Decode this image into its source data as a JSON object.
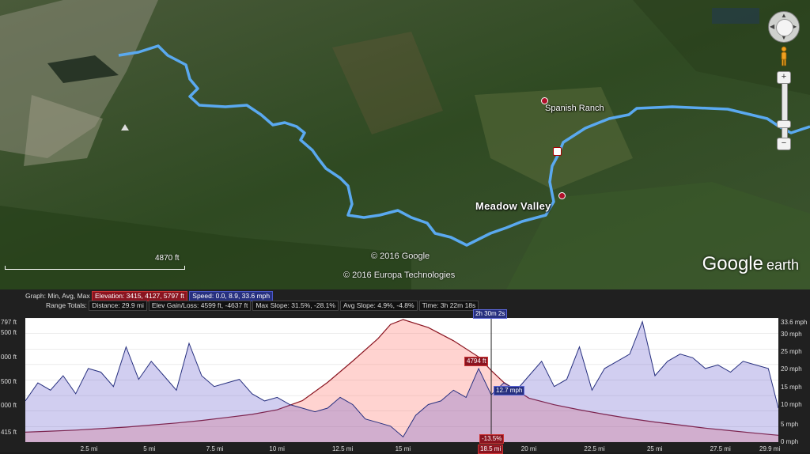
{
  "map": {
    "places": {
      "spanish_ranch": "Spanish Ranch",
      "meadow_valley": "Meadow Valley"
    },
    "scale_label": "4870 ft",
    "credits": {
      "google": "© 2016 Google",
      "europa": "© 2016 Europa Technologies"
    },
    "brand": {
      "main": "Google",
      "suffix": "earth"
    },
    "route_color": "#5aa9f0"
  },
  "profile": {
    "graph_label": "Graph: Min, Avg, Max",
    "elevation_tag": "Elevation: 3415, 4127, 5797 ft",
    "speed_tag": "Speed: 0.0, 8.9, 33.6 mph",
    "range_label": "Range Totals:",
    "distance": "Distance: 29.9 mi",
    "gain_loss": "Elev Gain/Loss: 4599 ft, -4637 ft",
    "max_slope": "Max Slope: 31.5%, -28.1%",
    "avg_slope": "Avg Slope: 4.9%, -4.8%",
    "time": "Time: 3h 22m 18s",
    "cursor_time": "2h 30m 2s",
    "cursor_elev": "4794 ft",
    "cursor_speed": "12.7 mph",
    "cursor_slope": "-13.5%",
    "cursor_dist": "18.5 mi",
    "elev_color": "#8a1420",
    "speed_color": "#27307f"
  },
  "chart_data": {
    "type": "area",
    "x_unit": "mi",
    "x_ticks": [
      "2.5 mi",
      "5 mi",
      "7.5 mi",
      "10 mi",
      "12.5 mi",
      "15 mi",
      "18.5 mi",
      "20 mi",
      "22.5 mi",
      "25 mi",
      "27.5 mi",
      "29.9 mi"
    ],
    "y_left_ticks": [
      "797 ft",
      "500 ft",
      "000 ft",
      "500 ft",
      "000 ft",
      "415 ft"
    ],
    "y_right_ticks": [
      "33.6 mph",
      "30 mph",
      "25 mph",
      "20 mph",
      "15 mph",
      "10 mph",
      "5 mph",
      "0 mph"
    ],
    "xlim": [
      0,
      29.9
    ],
    "elev_ylim": [
      3415,
      5797
    ],
    "speed_ylim": [
      0,
      33.6
    ],
    "series": [
      {
        "name": "Elevation",
        "unit": "ft",
        "x": [
          0,
          1,
          2,
          3,
          4,
          5,
          6,
          7,
          8,
          9,
          10,
          11,
          12,
          13,
          14,
          14.5,
          15,
          16,
          17,
          18,
          18.5,
          19,
          20,
          21,
          22,
          23,
          24,
          25,
          26,
          27,
          28,
          29,
          29.9
        ],
        "values": [
          3580,
          3600,
          3620,
          3650,
          3680,
          3720,
          3760,
          3810,
          3870,
          3930,
          4020,
          4200,
          4560,
          4980,
          5420,
          5700,
          5797,
          5640,
          5380,
          5060,
          4794,
          4560,
          4250,
          4120,
          4020,
          3930,
          3850,
          3780,
          3720,
          3660,
          3610,
          3560,
          3520
        ]
      },
      {
        "name": "Speed",
        "unit": "mph",
        "x": [
          0,
          0.5,
          1,
          1.5,
          2,
          2.5,
          3,
          3.5,
          4,
          4.5,
          5,
          5.5,
          6,
          6.5,
          7,
          7.5,
          8,
          8.5,
          9,
          9.5,
          10,
          10.5,
          11,
          11.5,
          12,
          12.5,
          13,
          13.5,
          14,
          14.5,
          15,
          15.5,
          16,
          16.5,
          17,
          17.5,
          18,
          18.5,
          19,
          19.5,
          20,
          20.5,
          21,
          21.5,
          22,
          22.5,
          23,
          23.5,
          24,
          24.5,
          25,
          25.5,
          26,
          26.5,
          27,
          27.5,
          28,
          28.5,
          29,
          29.5,
          29.9
        ],
        "values": [
          11,
          16,
          14,
          18,
          13,
          20,
          19,
          15,
          26,
          17,
          22,
          18,
          14,
          27,
          18,
          15,
          16,
          17,
          13,
          11,
          12,
          10,
          9,
          8,
          9,
          12,
          10,
          6,
          5,
          4,
          1,
          7,
          10,
          11,
          14,
          12,
          20,
          12.7,
          16,
          14,
          18,
          22,
          15,
          17,
          26,
          14,
          20,
          22,
          24,
          33,
          18,
          22,
          24,
          23,
          20,
          21,
          19,
          22,
          21,
          20,
          9
        ]
      }
    ]
  }
}
